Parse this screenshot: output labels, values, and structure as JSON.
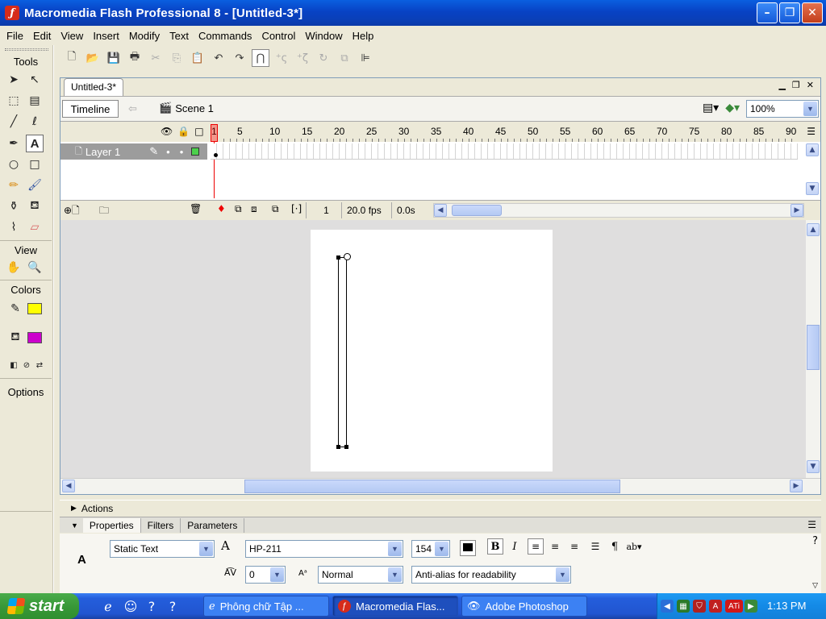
{
  "window": {
    "title": "Macromedia Flash Professional 8 - [Untitled-3*]",
    "app_icon": "flash-f"
  },
  "menu": [
    "File",
    "Edit",
    "View",
    "Insert",
    "Modify",
    "Text",
    "Commands",
    "Control",
    "Window",
    "Help"
  ],
  "tools": {
    "title": "Tools",
    "view_label": "View",
    "colors_label": "Colors",
    "options_label": "Options",
    "stroke_color": "#000000",
    "fill_color": "#ffff00",
    "text_fill_color": "#cc00cc",
    "selected_tool": "text-tool"
  },
  "document": {
    "tab": "Untitled-3*",
    "timeline_button": "Timeline",
    "scene": "Scene 1",
    "zoom": "100%"
  },
  "timeline": {
    "frame_numbers": [
      "1",
      "5",
      "10",
      "15",
      "20",
      "25",
      "30",
      "35",
      "40",
      "45",
      "50",
      "55",
      "60",
      "65",
      "70",
      "75",
      "80",
      "85",
      "90"
    ],
    "layer_name": "Layer 1",
    "current_frame": "1",
    "fps": "20.0 fps",
    "elapsed": "0.0s"
  },
  "panels": {
    "actions": "Actions",
    "tabs": [
      "Properties",
      "Filters",
      "Parameters"
    ]
  },
  "properties": {
    "text_type": "Static Text",
    "font": "HP-211",
    "font_size": "154",
    "letter_spacing": "0",
    "character_position": "Normal",
    "anti_alias": "Anti-alias for readability",
    "text_color": "#000000"
  },
  "taskbar": {
    "start": "start",
    "items": [
      "Phông chữ Tập ...",
      "Macromedia Flas...",
      "Adobe Photoshop"
    ],
    "clock": "1:13 PM"
  }
}
